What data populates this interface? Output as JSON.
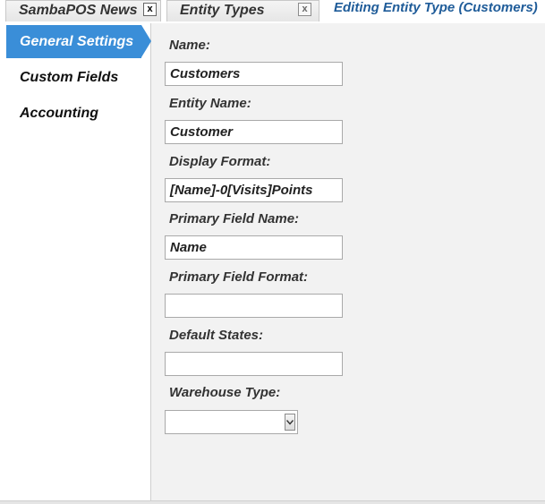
{
  "tabs": [
    {
      "label": "SambaPOS News",
      "close": "x"
    },
    {
      "label": "Entity Types",
      "close": "x"
    }
  ],
  "page_title": "Editing Entity Type (Customers)",
  "sidebar": {
    "items": [
      {
        "label": "General Settings",
        "active": true
      },
      {
        "label": "Custom Fields",
        "active": false
      },
      {
        "label": "Accounting",
        "active": false
      }
    ]
  },
  "form": {
    "name_label": "Name:",
    "name_value": "Customers",
    "entity_name_label": "Entity Name:",
    "entity_name_value": "Customer",
    "display_format_label": "Display Format:",
    "display_format_value": "[Name]-0[Visits]Points",
    "primary_field_name_label": "Primary Field Name:",
    "primary_field_name_value": "Name",
    "primary_field_format_label": "Primary Field Format:",
    "primary_field_format_value": "",
    "default_states_label": "Default States:",
    "default_states_value": "",
    "warehouse_type_label": "Warehouse Type:",
    "warehouse_type_value": ""
  },
  "icons": {
    "close": "close-icon",
    "dropdown": "chevron-down-icon"
  },
  "colors": {
    "accent": "#3a8ed8",
    "title": "#1f5c99"
  }
}
